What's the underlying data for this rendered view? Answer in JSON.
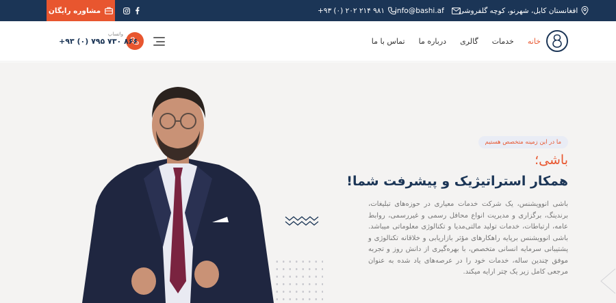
{
  "topbar": {
    "cta_label": "مشاوره رایگان",
    "address": "افغانستان کابل، شهرنو، کوچه گلفروشی",
    "email": "info@bashi.af",
    "phone": "+۹۳ (۰) ۲۰۲ ۲۱۴ ۹۸۱"
  },
  "nav": {
    "items": [
      "خانه",
      "خدمات",
      "گالری",
      "درباره ما",
      "تماس با ما"
    ],
    "active_index": 0
  },
  "contact": {
    "label": "واتساپ",
    "phone": "+۹۳ (۰) ۷۹۵ ۷۳۰ ۸۶۶"
  },
  "hero": {
    "tag": "ما در این زمینه متخصص هستیم",
    "subtitle": "باشی؛",
    "title": "همکار استراتیژیک و پیشرفت شما!",
    "description": "باشی انوویشنس، یک شرکت خدمات معیاری در حوزه‌های تبلیغات، برندینگ، برگزاری و مدیریت انواع محافل رسمی و غیررسمی، روابط عامه، ارتباطات، خدمات تولید مالتی‌مدیا و تکنالوژی معلوماتی میباشد. باشی انوویشنس برپایه راهکارهای مؤثر بازاریابی و خلاقانه تکنالوژی و پشتیبانی سرمایه انسانی متخصص، با بهره‌گیری از دانش روز و تجربه موفق چندین ساله، خدمات خود را در عرصه‌های یاد شده به عنوان مرجعی کامل زیر یک چتر ارایه میکند."
  },
  "colors": {
    "navy": "#1b3556",
    "accent": "#e8562f",
    "hero_bg": "#f4f3f2"
  },
  "icons": [
    "briefcase-icon",
    "instagram-icon",
    "facebook-icon",
    "location-icon",
    "mail-icon",
    "phone-icon",
    "menu-icon",
    "logo-icon"
  ]
}
